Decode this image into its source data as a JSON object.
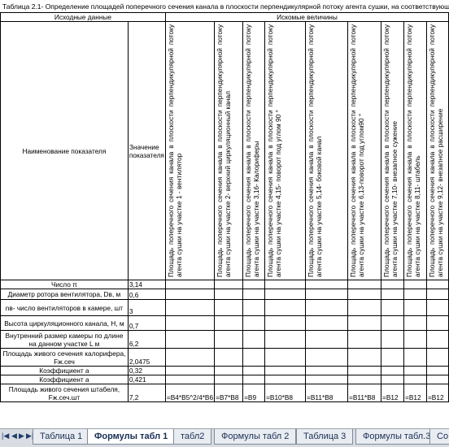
{
  "title": "Таблица 2.1- Определение площадей поперечного сечения канала в плоскости перпендикулярной потоку агента сушки, на соответствующем",
  "headers": {
    "source": "Исходные данные",
    "sought": "Искомые величины",
    "name": "Наименование показателя",
    "value": "Значение показателя"
  },
  "columns": [
    "Площадь поперечного сечения канала в плоскости перпендикулярной потоку агента сушки на участке 1 - вентилятор",
    "Площадь поперечного сечения канала в плоскости перпендикулярной потоку агента сушки на участке 2- верхний циркуляционный канал",
    "Площадь поперечного сечения канала в плоскости перпендикулярной потоку агента сушки на участке 3,16- Калориферы",
    "Площадь поперечного сечения канала в плоскости перпендикулярной потоку агента сушки на участке 4,15- поворот под углом 90 °",
    "Площадь поперечного сечения канала в плоскости перпендикулярной потоку агента сушки на участке 5,14- боковой канал",
    "Площадь поперечного сечения канала в плоскости перпендикулярной потоку агента сушки на участке 6,13-поворот под углом90 °",
    "Площадь поперечного сечения канала в плоскости перпендикулярной потоку агента сушки на участке 7,10- внезапное сужение",
    "Площадь поперечного сечения канала в плоскости перпендикулярной потоку агента сушки на участке 8,11- штабель",
    "Площадь поперечного сечения канала в плоскости перпендикулярной потоку агента сушки на участке 9,12- внезапное расширение"
  ],
  "rows": [
    {
      "name": "Число π",
      "value": "3,14"
    },
    {
      "name": "Диаметр ротора вентилятора, Dв, м",
      "value": "0,6"
    },
    {
      "name": "nв- число вентиляторов в камере, шт",
      "value": "3"
    },
    {
      "name": "Высота циркуляционного канала, H, м",
      "value": "0,7"
    },
    {
      "name": "Внутренний размер камеры по длине на данном участке L м",
      "value": "6,2"
    },
    {
      "name": "Площадь живого сечения калорифера, Fж.сеч",
      "value": "2,0475"
    },
    {
      "name": "Коэффициент a",
      "value": "0,32"
    },
    {
      "name": "Коэффициент a",
      "value": "0,421"
    },
    {
      "name": "Площадь живого сечения штабеля, Fж.сеч.шт",
      "value": "7,2"
    }
  ],
  "formulas": [
    "=B4*B5^2/4*B6",
    "=B7*B8",
    "=B9",
    "=B10*B8",
    "=B11*B8",
    "=B11*B8",
    "=B12",
    "=B12",
    "=B12"
  ],
  "sheet_tabs": [
    "Таблица 1",
    "Формулы табл 1",
    "табл2",
    "Формулы табл 2",
    "Таблица 3",
    "Формулы табл.3",
    "Со"
  ],
  "active_tab": "Формулы табл 1",
  "nav_icons": [
    "first-sheet-icon",
    "prev-sheet-icon",
    "next-sheet-icon",
    "last-sheet-icon"
  ]
}
